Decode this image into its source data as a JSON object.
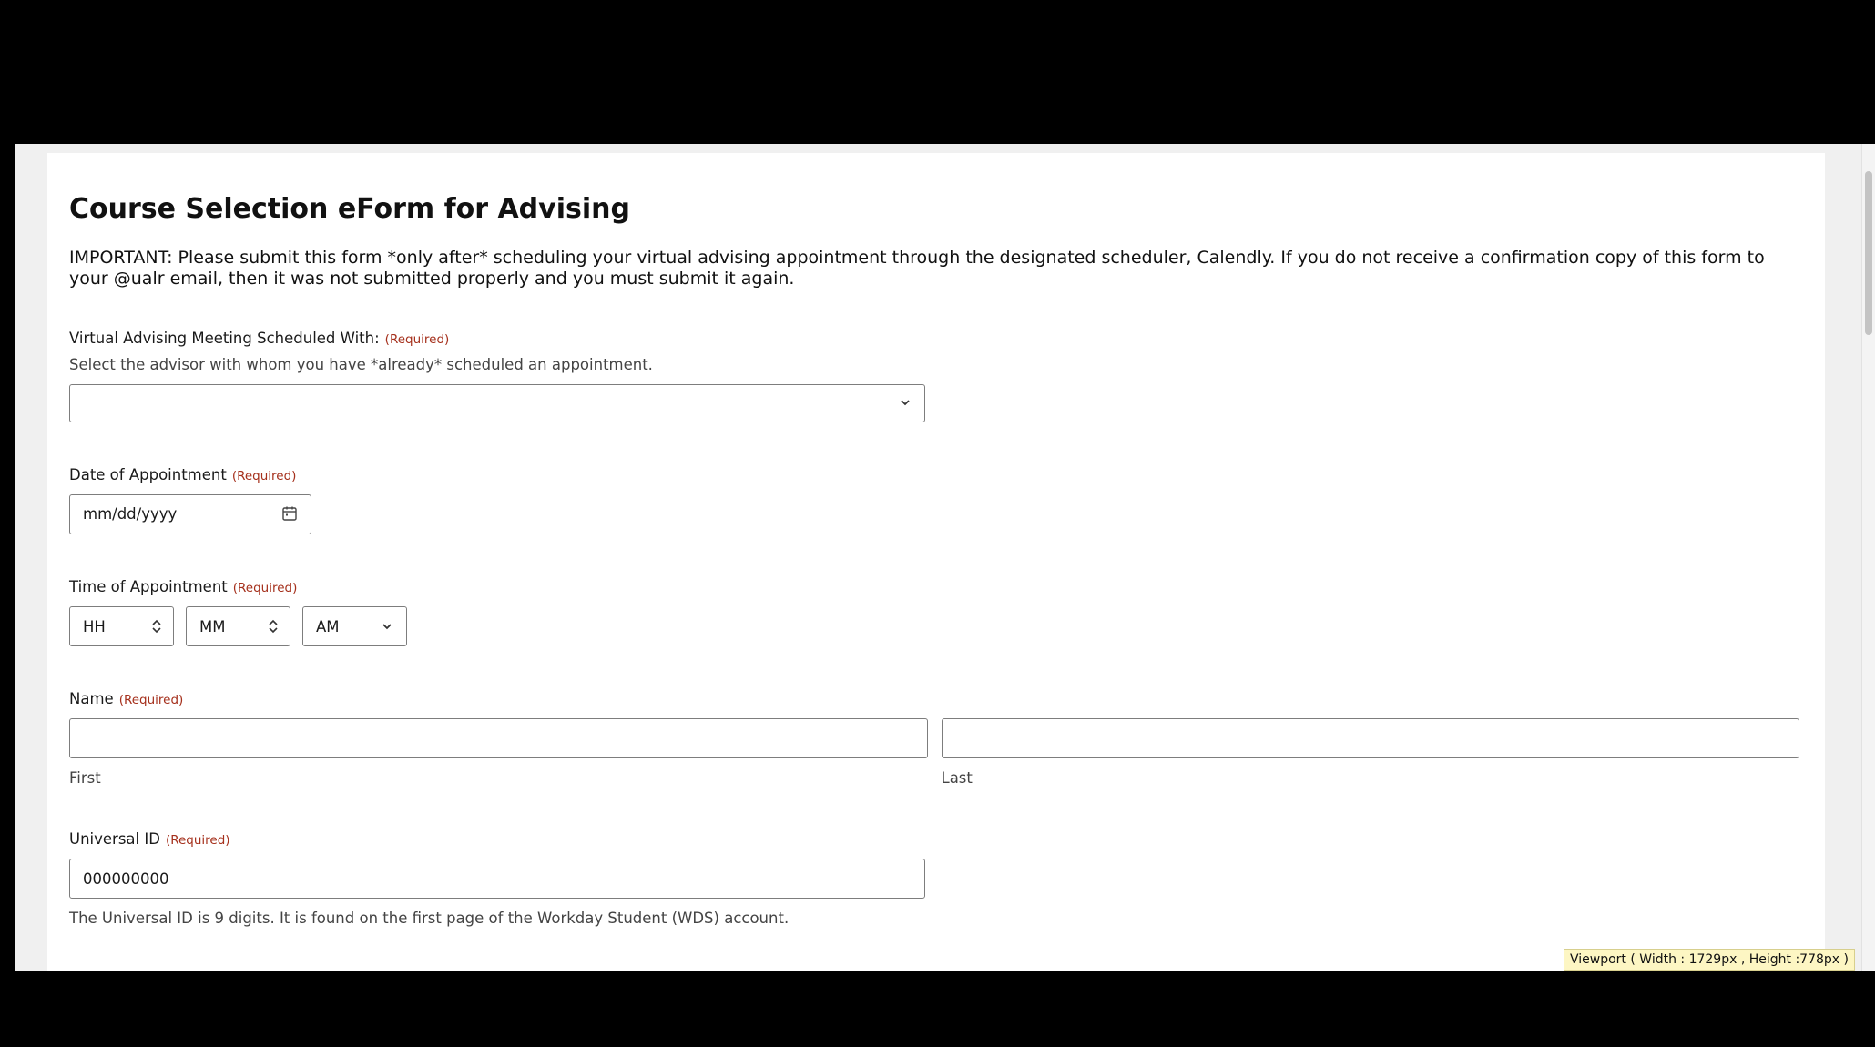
{
  "form": {
    "title": "Course Selection eForm for Advising",
    "important_text": "IMPORTANT: Please submit this form *only after* scheduling your virtual advising appointment through the designated scheduler, Calendly. If you do not receive a confirmation copy of this form to your @ualr email, then it was not submitted properly and you must submit it again.",
    "required_tag": "(Required)"
  },
  "advisor": {
    "label": "Virtual Advising Meeting Scheduled With:",
    "description": "Select the advisor with whom you have *already* scheduled an appointment.",
    "selected": ""
  },
  "date": {
    "label": "Date of Appointment",
    "placeholder": "mm/dd/yyyy"
  },
  "time": {
    "label": "Time of Appointment",
    "hour_placeholder": "HH",
    "minute_placeholder": "MM",
    "ampm_selected": "AM"
  },
  "name": {
    "label": "Name",
    "first_sublabel": "First",
    "last_sublabel": "Last",
    "first_value": "",
    "last_value": ""
  },
  "universal_id": {
    "label": "Universal ID",
    "value": "000000000",
    "description": "The Universal ID is 9 digits. It is found on the first page of the Workday Student (WDS) account."
  },
  "viewport_tooltip": "Viewport ( Width : 1729px , Height :778px )",
  "icons": {
    "advisor_dropdown": "chevron-down-icon",
    "date_picker": "calendar-icon",
    "hour_spinner": "spinner-arrows-icon",
    "minute_spinner": "spinner-arrows-icon",
    "ampm_dropdown": "chevron-down-icon"
  }
}
